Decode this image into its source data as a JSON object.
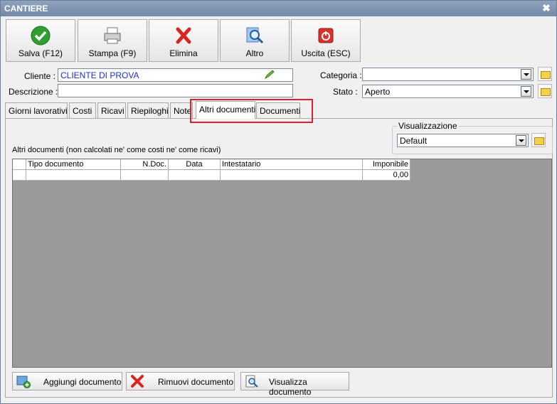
{
  "window": {
    "title": "CANTIERE",
    "close_glyph": "✖"
  },
  "toolbar": {
    "save": "Salva (F12)",
    "print": "Stampa (F9)",
    "delete": "Elimina",
    "other": "Altro",
    "exit": "Uscita (ESC)"
  },
  "form": {
    "cliente_label": "Cliente :",
    "cliente_value": "CLIENTE DI PROVA",
    "descrizione_label": "Descrizione :",
    "descrizione_value": "",
    "categoria_label": "Categoria :",
    "categoria_value": "",
    "stato_label": "Stato :",
    "stato_value": "Aperto"
  },
  "tabs": [
    "Giorni lavorativi",
    "Costi",
    "Ricavi",
    "Riepiloghi",
    "Note",
    "Altri documenti",
    "Documenti"
  ],
  "active_tab": "Altri documenti",
  "visualizzazione": {
    "label": "Visualizzazione",
    "value": "Default"
  },
  "section_caption": "Altri documenti (non calcolati ne' come costi ne' come ricavi)",
  "grid": {
    "columns": [
      "Tipo documento",
      "N.Doc.",
      "Data",
      "Intestatario",
      "Imponibile"
    ],
    "rows": [
      {
        "tipo": "",
        "ndoc": "",
        "data": "",
        "intestatario": "",
        "imponibile": "0,00"
      }
    ]
  },
  "actions": {
    "add": "Aggiungi documento",
    "remove": "Rimuovi documento",
    "view": "Visualizza documento"
  },
  "colors": {
    "titlebar": "#7f94b1",
    "highlight": "#e0202a",
    "cliente_text": "#1a2fd6",
    "grid_bg": "#9a9a9a"
  }
}
